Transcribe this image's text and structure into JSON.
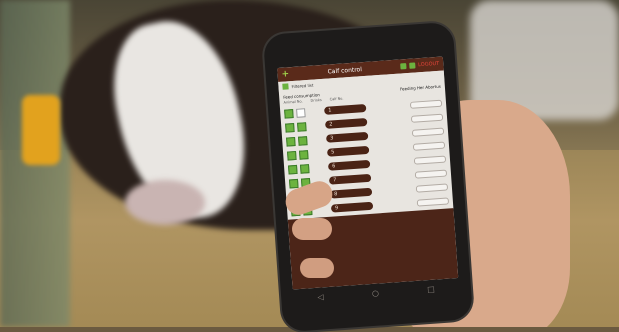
{
  "app": {
    "title": "Calf control",
    "add_icon": "plus-icon",
    "logout_label": "LOGOUT"
  },
  "filter": {
    "label": "Filtered list"
  },
  "list": {
    "section_title": "Feed consumption",
    "section_right": "Feeding Her   Abortus",
    "column_headers": [
      "Animal No.",
      "Drinks",
      "Calf No."
    ],
    "rows": [
      {
        "number": "1",
        "checked_a": true,
        "checked_b": false
      },
      {
        "number": "2",
        "checked_a": true,
        "checked_b": true
      },
      {
        "number": "3",
        "checked_a": true,
        "checked_b": true
      },
      {
        "number": "5",
        "checked_a": true,
        "checked_b": true
      },
      {
        "number": "6",
        "checked_a": true,
        "checked_b": true
      },
      {
        "number": "7",
        "checked_a": true,
        "checked_b": true
      },
      {
        "number": "8",
        "checked_a": true,
        "checked_b": true
      },
      {
        "number": "9",
        "checked_a": true,
        "checked_b": true
      },
      {
        "number": "10",
        "checked_a": true,
        "checked_b": true
      },
      {
        "number": "11",
        "checked_a": true,
        "checked_b": true
      }
    ]
  },
  "colors": {
    "brand": "#5a2a1a",
    "accent": "#6cb33f",
    "logout": "#e7453b"
  }
}
